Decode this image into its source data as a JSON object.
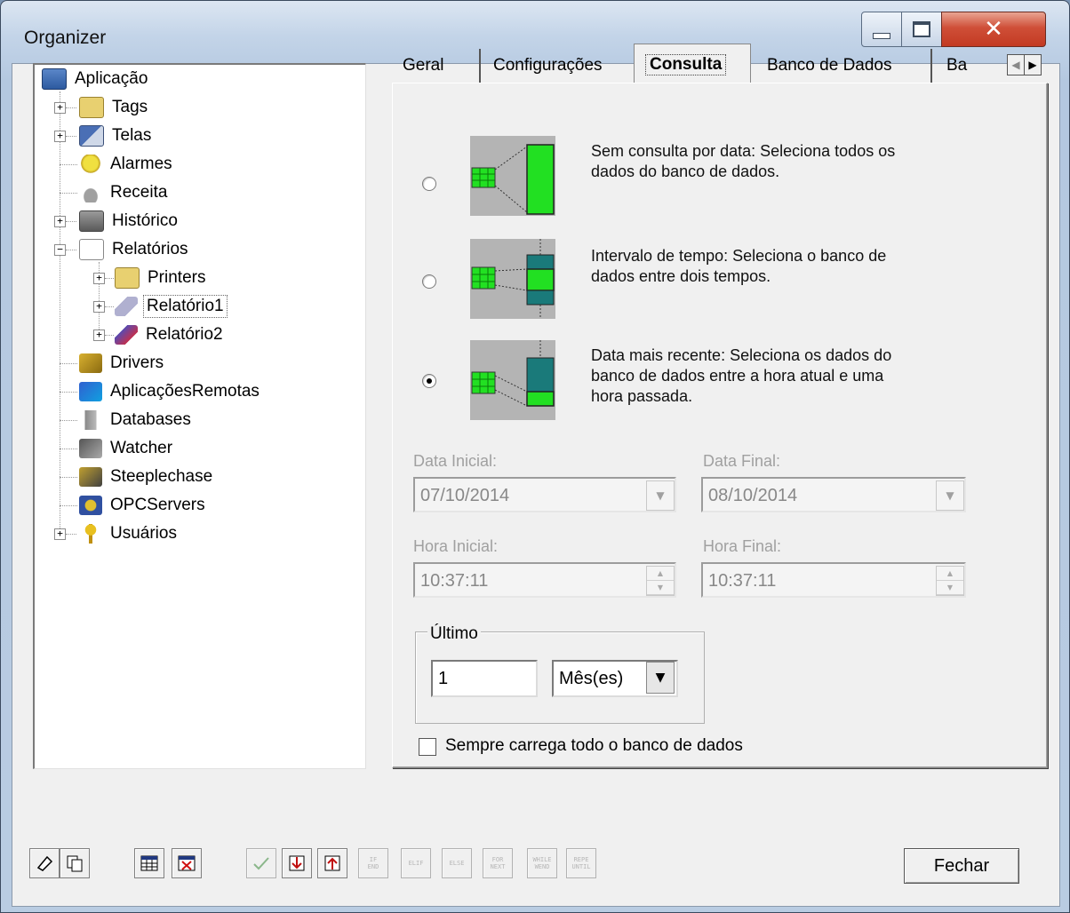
{
  "window": {
    "title": "Organizer"
  },
  "tree": {
    "items": [
      {
        "label": "Aplicação"
      },
      {
        "label": "Tags"
      },
      {
        "label": "Telas"
      },
      {
        "label": "Alarmes"
      },
      {
        "label": "Receita"
      },
      {
        "label": "Histórico"
      },
      {
        "label": "Relatórios"
      },
      {
        "label": "Printers"
      },
      {
        "label": "Relatório1"
      },
      {
        "label": "Relatório2"
      },
      {
        "label": "Drivers"
      },
      {
        "label": "AplicaçõesRemotas"
      },
      {
        "label": "Databases"
      },
      {
        "label": "Watcher"
      },
      {
        "label": "Steeplechase"
      },
      {
        "label": "OPCServers"
      },
      {
        "label": "Usuários"
      }
    ]
  },
  "tabs": [
    {
      "label": "Geral"
    },
    {
      "label": "Configurações"
    },
    {
      "label": "Consulta"
    },
    {
      "label": "Banco de Dados"
    },
    {
      "label": "Ba"
    }
  ],
  "consulta": {
    "options": [
      {
        "text": "Sem consulta por data: Seleciona todos os dados do banco de dados.",
        "selected": false
      },
      {
        "text": "Intervalo de tempo: Seleciona o banco de dados entre dois tempos.",
        "selected": false
      },
      {
        "text": "Data mais recente: Seleciona os dados do banco de dados entre a hora atual e uma hora passada.",
        "selected": true
      }
    ],
    "data_inicial_label": "Data Inicial:",
    "data_inicial_value": "07/10/2014",
    "data_final_label": "Data Final:",
    "data_final_value": "08/10/2014",
    "hora_inicial_label": "Hora Inicial:",
    "hora_inicial_value": "10:37:11",
    "hora_final_label": "Hora Final:",
    "hora_final_value": "10:37:11",
    "ultimo_label": "Último",
    "ultimo_value": "1",
    "ultimo_unit": "Mês(es)",
    "checkbox_label": "Sempre carrega todo o banco de dados",
    "checkbox_checked": false
  },
  "toolbar": {
    "script_buttons": [
      {
        "top": "IF",
        "bottom": "END"
      },
      {
        "top": "ELIF",
        "bottom": ""
      },
      {
        "top": "ELSE",
        "bottom": ""
      },
      {
        "top": "FOR",
        "bottom": "NEXT"
      },
      {
        "top": "WHILE",
        "bottom": "WEND"
      },
      {
        "top": "REPE",
        "bottom": "UNTIL"
      }
    ]
  },
  "buttons": {
    "close": "Fechar"
  },
  "colors": {
    "green": "#22e022",
    "teal": "#1a7a7a",
    "diagram_bg": "#b4b4b4"
  }
}
